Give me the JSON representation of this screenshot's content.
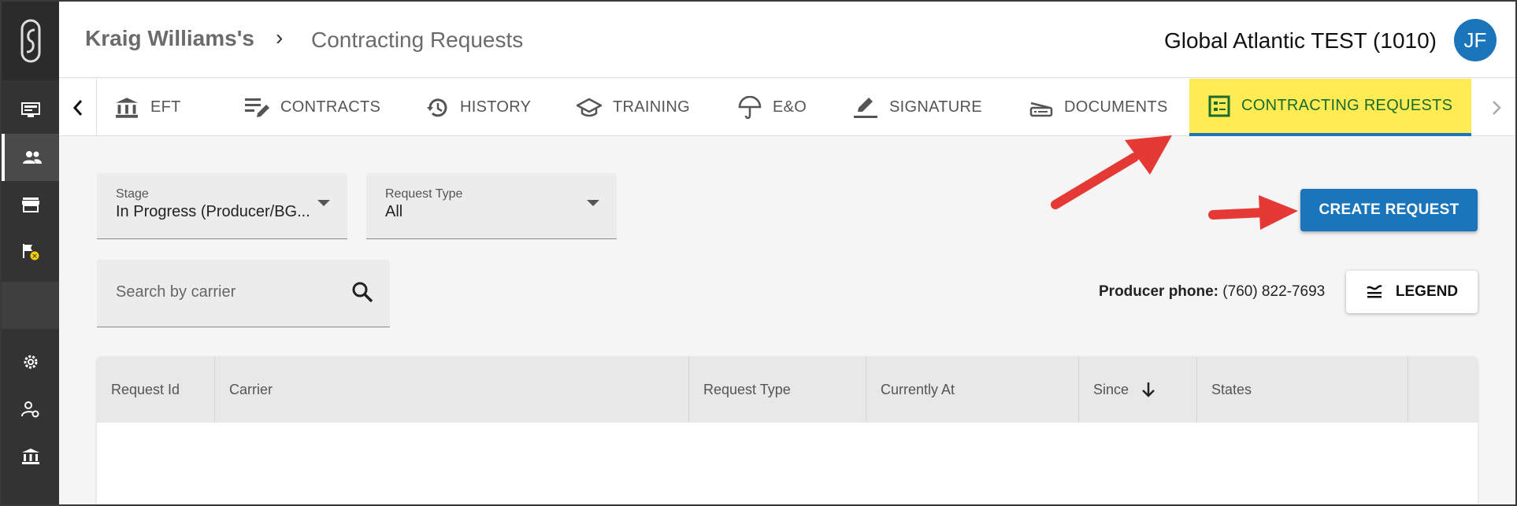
{
  "header": {
    "breadcrumb_owner": "Kraig Williams's",
    "breadcrumb_separator": "›",
    "breadcrumb_page": "Contracting Requests",
    "agency": "Global Atlantic TEST (1010)",
    "avatar_initials": "JF"
  },
  "rail": {
    "items": [
      "logo-icon",
      "monitor-icon",
      "people-icon",
      "store-icon",
      "flag-icon",
      "settings-icon",
      "user-settings-icon",
      "bank-icon"
    ]
  },
  "tabs": [
    {
      "label": "EFT",
      "icon": "bank-icon"
    },
    {
      "label": "CONTRACTS",
      "icon": "contracts-icon"
    },
    {
      "label": "HISTORY",
      "icon": "history-icon"
    },
    {
      "label": "TRAINING",
      "icon": "school-icon"
    },
    {
      "label": "E&O",
      "icon": "umbrella-icon"
    },
    {
      "label": "SIGNATURE",
      "icon": "pen-icon"
    },
    {
      "label": "DOCUMENTS",
      "icon": "scanner-icon"
    },
    {
      "label": "CONTRACTING REQUESTS",
      "icon": "list-icon",
      "active": true
    }
  ],
  "filters": {
    "stage_label": "Stage",
    "stage_value": "In Progress (Producer/BG...",
    "request_type_label": "Request Type",
    "request_type_value": "All",
    "search_placeholder": "Search by carrier"
  },
  "actions": {
    "create_request": "CREATE REQUEST",
    "legend": "LEGEND"
  },
  "producer": {
    "phone_label": "Producer phone:",
    "phone_value": "(760) 822-7693"
  },
  "table": {
    "columns": [
      "Request Id",
      "Carrier",
      "Request Type",
      "Currently At",
      "Since",
      "States"
    ],
    "sort_column": "Since",
    "rows": []
  },
  "colors": {
    "accent": "#1a75bb",
    "active_tab_bg": "#ffeb54",
    "active_tab_text": "#1a6b2e",
    "annotation_arrow": "#e53935"
  }
}
